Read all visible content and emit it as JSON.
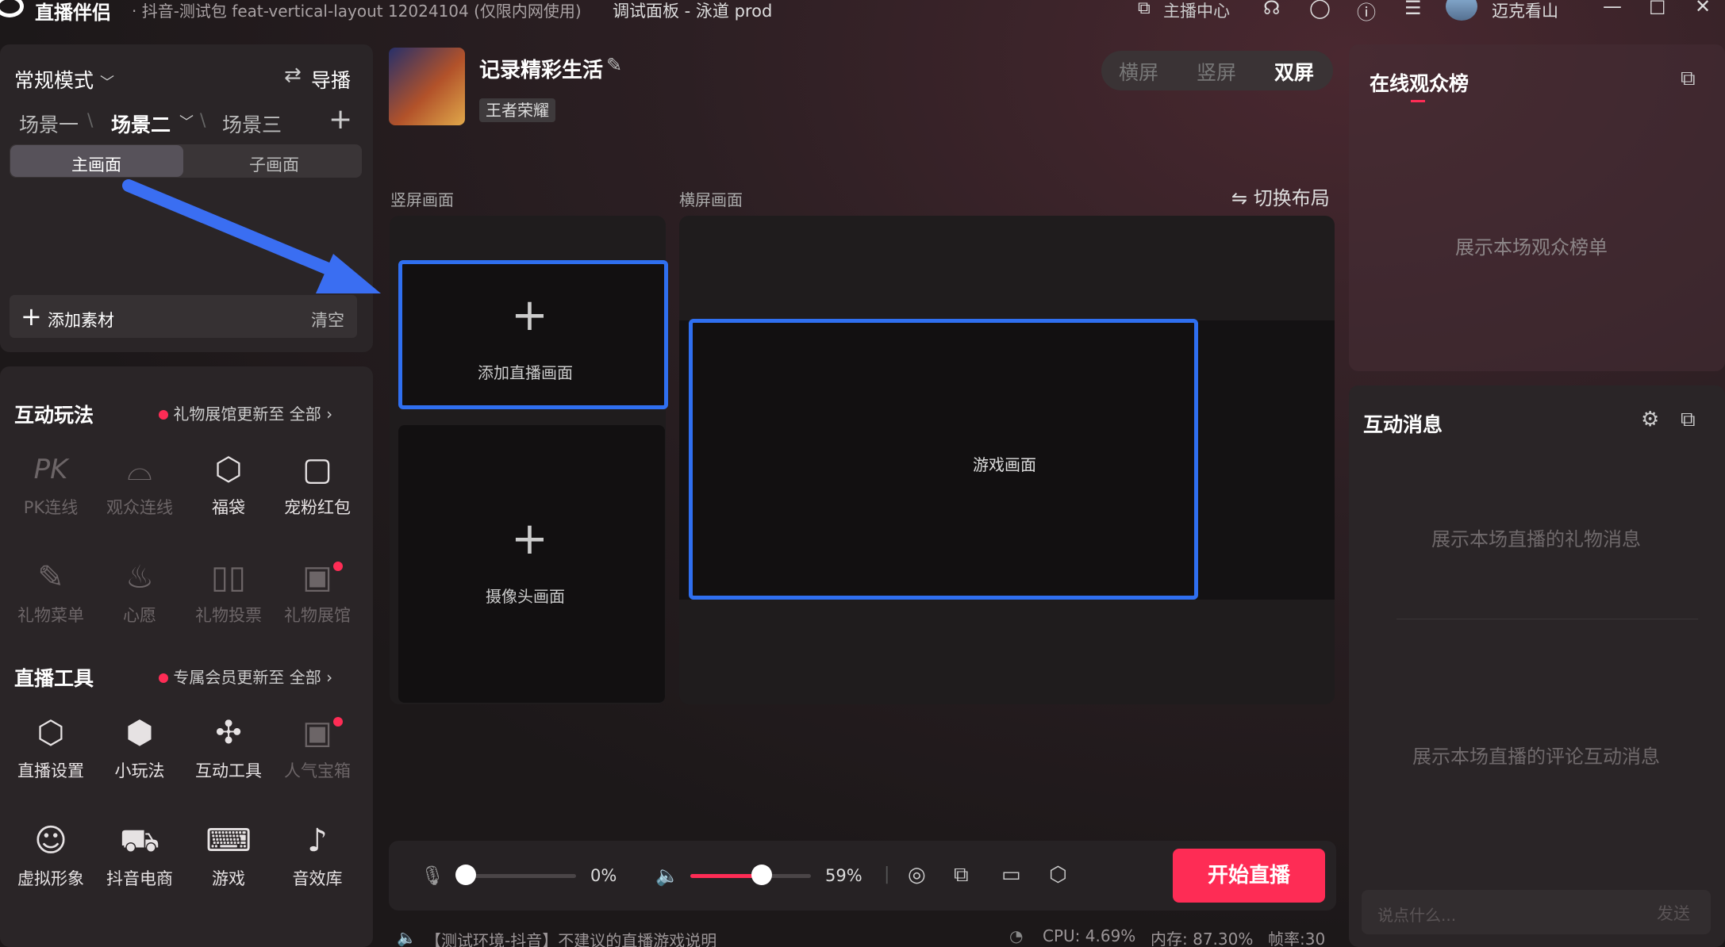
{
  "titlebar": {
    "app_name": "直播伴侣",
    "subtitle": "· 抖音-测试包 feat-vertical-layout 12024104 (仅限内网使用)",
    "debug_panel": "调试面板 - 泳道 prod",
    "host_center": "主播中心",
    "username": "迈克看山"
  },
  "left": {
    "mode": "常规模式",
    "director": "导播",
    "scenes": [
      "场景一",
      "场景二",
      "场景三"
    ],
    "screen_tabs": [
      "主画面",
      "子画面"
    ],
    "add_material": "添加素材",
    "clear": "清空",
    "interactive": {
      "title": "互动玩法",
      "update_note": "礼物展馆更新至",
      "all": "全部",
      "items": [
        {
          "label": "PK连线",
          "icon": "pk-icon",
          "enabled": false
        },
        {
          "label": "观众连线",
          "icon": "audience-link-icon",
          "enabled": false
        },
        {
          "label": "福袋",
          "icon": "lucky-bag-icon",
          "enabled": true
        },
        {
          "label": "宠粉红包",
          "icon": "red-packet-icon",
          "enabled": true
        },
        {
          "label": "礼物菜单",
          "icon": "gift-menu-icon",
          "enabled": false
        },
        {
          "label": "心愿",
          "icon": "wish-icon",
          "enabled": false
        },
        {
          "label": "礼物投票",
          "icon": "gift-vote-icon",
          "enabled": false
        },
        {
          "label": "礼物展馆",
          "icon": "gift-gallery-icon",
          "enabled": false
        }
      ]
    },
    "tools": {
      "title": "直播工具",
      "update_note": "专属会员更新至",
      "all": "全部",
      "items": [
        {
          "label": "直播设置",
          "icon": "live-settings-icon",
          "enabled": true
        },
        {
          "label": "小玩法",
          "icon": "mini-game-icon",
          "enabled": true
        },
        {
          "label": "互动工具",
          "icon": "puzzle-icon",
          "enabled": true
        },
        {
          "label": "人气宝箱",
          "icon": "treasure-box-icon",
          "enabled": false
        },
        {
          "label": "虚拟形象",
          "icon": "avatar-icon",
          "enabled": true
        },
        {
          "label": "抖音电商",
          "icon": "cart-icon",
          "enabled": true
        },
        {
          "label": "游戏",
          "icon": "gamepad-icon",
          "enabled": true
        },
        {
          "label": "音效库",
          "icon": "sound-library-icon",
          "enabled": true
        }
      ]
    }
  },
  "center": {
    "stream_title": "记录精彩生活",
    "category": "王者荣耀",
    "orientation_tabs": [
      "横屏",
      "竖屏",
      "双屏"
    ],
    "active_orientation": "双屏",
    "vertical_label": "竖屏画面",
    "horizontal_label": "横屏画面",
    "switch_layout": "切换布局",
    "add_live_screen": "添加直播画面",
    "camera_screen": "摄像头画面",
    "game_screen": "游戏画面",
    "mic_volume": "0%",
    "speaker_volume": "59%",
    "mic_level": 0,
    "speaker_level": 0.59,
    "start_button": "开始直播",
    "status_note": "【测试环境-抖音】不建议的直播游戏说明",
    "cpu": "CPU: 4.69%",
    "memory": "内存: 87.30%",
    "fps": "帧率:30"
  },
  "right": {
    "ranking_title": "在线观众榜",
    "ranking_placeholder": "展示本场观众榜单",
    "messages_title": "互动消息",
    "gift_placeholder": "展示本场直播的礼物消息",
    "comment_placeholder": "展示本场直播的评论互动消息",
    "input_placeholder": "说点什么...",
    "send": "发送"
  },
  "colors": {
    "accent": "#fe2c55",
    "frame_blue": "#2f6ff0",
    "arrow_blue": "#3a6ef2"
  }
}
